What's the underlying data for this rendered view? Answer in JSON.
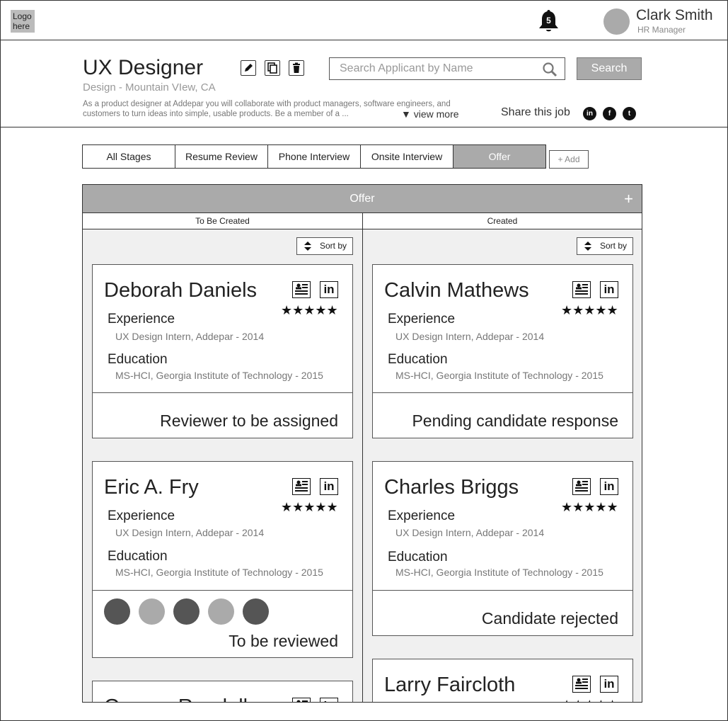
{
  "header": {
    "logo_text": "Logo here",
    "notification_count": "5",
    "user_name": "Clark Smith",
    "user_role": "HR Manager"
  },
  "job": {
    "title": "UX Designer",
    "location": "Design - Mountain VIew, CA",
    "description": "As a product designer at Addepar you will collaborate with product managers, software engineers, and customers to turn ideas into simple, usable products. Be a member of a ...",
    "view_more": "▼ view more",
    "search_placeholder": "Search Applicant by Name",
    "search_button": "Search",
    "share_label": "Share this job",
    "social": [
      "in",
      "f",
      "t"
    ]
  },
  "tabs": [
    {
      "label": "All Stages",
      "active": false
    },
    {
      "label": "Resume Review",
      "active": false
    },
    {
      "label": "Phone Interview",
      "active": false
    },
    {
      "label": "Onsite Interview",
      "active": false
    },
    {
      "label": "Offer",
      "active": true
    }
  ],
  "add_tab_label": "+ Add",
  "board": {
    "title": "Offer",
    "plus": "+",
    "sort_label": "Sort by",
    "columns": [
      {
        "title": "To Be Created",
        "cards": [
          {
            "name": "Deborah Daniels",
            "stars": "★★★★★",
            "experience_label": "Experience",
            "experience": "UX Design Intern, Addepar - 2014",
            "education_label": "Education",
            "education": "MS-HCI, Georgia Institute of Technology - 2015",
            "status": "Reviewer to be assigned"
          },
          {
            "name": "Eric A. Fry",
            "stars": "★★★★★",
            "experience_label": "Experience",
            "experience": "UX Design Intern, Addepar - 2014",
            "education_label": "Education",
            "education": "MS-HCI, Georgia Institute of Technology - 2015",
            "status": "To be reviewed",
            "reviewer_dots": [
              "#555555",
              "#aaaaaa",
              "#555555",
              "#aaaaaa",
              "#555555"
            ]
          },
          {
            "name": "George Rundell",
            "stars": "★★★★★"
          }
        ]
      },
      {
        "title": "Created",
        "cards": [
          {
            "name": "Calvin Mathews",
            "stars": "★★★★★",
            "experience_label": "Experience",
            "experience": "UX Design Intern, Addepar - 2014",
            "education_label": "Education",
            "education": "MS-HCI, Georgia Institute of Technology - 2015",
            "status": "Pending candidate response"
          },
          {
            "name": "Charles Briggs",
            "stars": "★★★★★",
            "experience_label": "Experience",
            "experience": "UX Design Intern, Addepar - 2014",
            "education_label": "Education",
            "education": "MS-HCI, Georgia Institute of Technology - 2015",
            "status": "Candidate rejected"
          },
          {
            "name": "Larry Faircloth",
            "stars": "★★★★★"
          }
        ]
      }
    ]
  }
}
